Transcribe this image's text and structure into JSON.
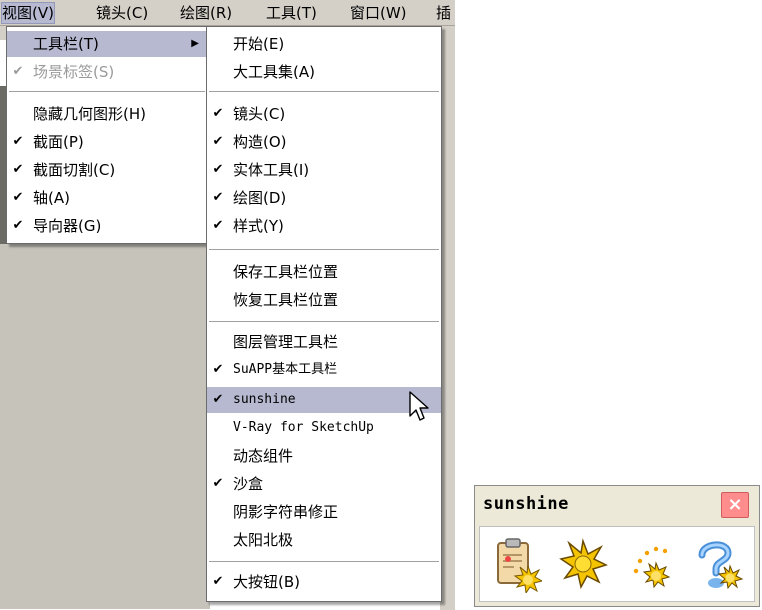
{
  "menubar": {
    "items": [
      {
        "label": "视图(V)"
      },
      {
        "label": "镜头(C)"
      },
      {
        "label": "绘图(R)"
      },
      {
        "label": "工具(T)"
      },
      {
        "label": "窗口(W)"
      },
      {
        "label": "插"
      }
    ]
  },
  "view_menu": {
    "items": [
      {
        "label": "工具栏(T)",
        "checked": false,
        "submenu": true
      },
      {
        "label": "场景标签(S)",
        "checked": true,
        "disabled": true
      },
      {
        "label": "隐藏几何图形(H)",
        "checked": false
      },
      {
        "label": "截面(P)",
        "checked": true
      },
      {
        "label": "截面切割(C)",
        "checked": true
      },
      {
        "label": "轴(A)",
        "checked": true
      },
      {
        "label": "导向器(G)",
        "checked": true
      }
    ]
  },
  "toolbar_submenu": {
    "items": [
      {
        "label": "开始(E)",
        "checked": false
      },
      {
        "label": "大工具集(A)",
        "checked": false
      },
      {
        "label": "镜头(C)",
        "checked": true
      },
      {
        "label": "构造(O)",
        "checked": true
      },
      {
        "label": "实体工具(I)",
        "checked": true
      },
      {
        "label": "绘图(D)",
        "checked": true
      },
      {
        "label": "样式(Y)",
        "checked": true
      },
      {
        "label": "保存工具栏位置",
        "checked": false
      },
      {
        "label": "恢复工具栏位置",
        "checked": false
      },
      {
        "label": "图层管理工具栏",
        "checked": false
      },
      {
        "label": "SuAPP基本工具栏",
        "checked": true
      },
      {
        "label": "sunshine",
        "checked": true,
        "selected": true
      },
      {
        "label": "V-Ray for SketchUp",
        "checked": false
      },
      {
        "label": "动态组件",
        "checked": false
      },
      {
        "label": "沙盒",
        "checked": true
      },
      {
        "label": "阴影字符串修正",
        "checked": false
      },
      {
        "label": "太阳北极",
        "checked": false
      },
      {
        "label": "大按钮(B)",
        "checked": true
      }
    ]
  },
  "check_glyph": "✔",
  "submenu_arrow": "▶",
  "toolbar_window": {
    "title": "sunshine",
    "close_glyph": "×",
    "buttons": [
      {
        "icon": "clipboard-sun-icon"
      },
      {
        "icon": "sun-icon"
      },
      {
        "icon": "sun-path-icon"
      },
      {
        "icon": "help-sun-icon"
      }
    ]
  },
  "colors": {
    "menu_highlight": "#b6b9d0",
    "chrome": "#d4d0c8",
    "close_button": "#ff8d8d",
    "sun": "#f5c400"
  }
}
